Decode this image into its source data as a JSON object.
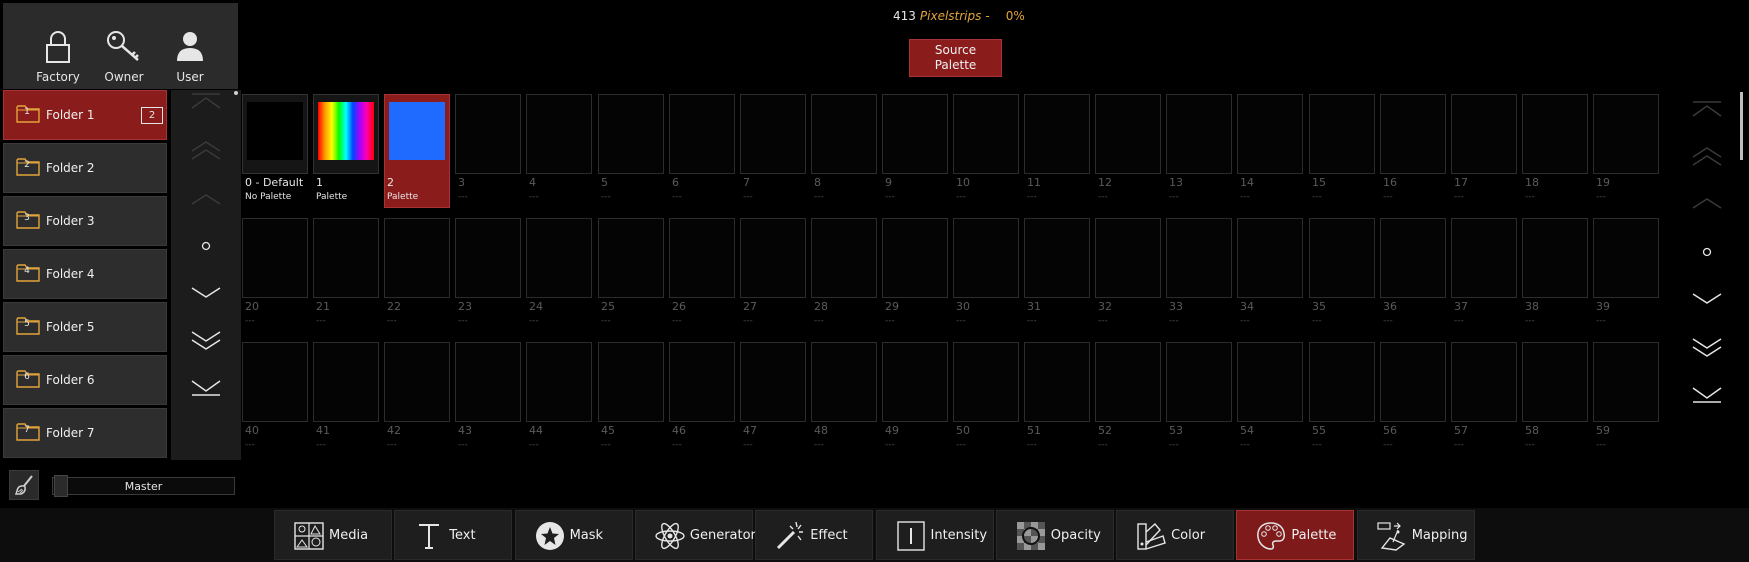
{
  "user_area": {
    "buttons": [
      {
        "label": "Factory",
        "icon": "lock-icon"
      },
      {
        "label": "Owner",
        "icon": "key-icon"
      },
      {
        "label": "User",
        "icon": "user-icon"
      }
    ]
  },
  "folders": [
    {
      "num": "1",
      "label": "Folder 1",
      "badge": "2",
      "active": true
    },
    {
      "num": "2",
      "label": "Folder 2"
    },
    {
      "num": "3",
      "label": "Folder 3"
    },
    {
      "num": "4",
      "label": "Folder 4"
    },
    {
      "num": "5",
      "label": "Folder 5"
    },
    {
      "num": "6",
      "label": "Folder 6"
    },
    {
      "num": "7",
      "label": "Folder 7"
    }
  ],
  "header": {
    "count": "413",
    "type": "Pixelstrips",
    "dash": "-",
    "percent": "0%"
  },
  "source_palette_button": {
    "line1": "Source",
    "line2": "Palette"
  },
  "grid": {
    "empty_sub": "---",
    "cells": [
      {
        "label": "0 - Default",
        "sub": "No Palette",
        "state": "used",
        "thumb": "none"
      },
      {
        "label": "1",
        "sub": "Palette",
        "state": "used",
        "thumb": "rainbow"
      },
      {
        "label": "2",
        "sub": "Palette",
        "state": "selected",
        "thumb": "blue"
      }
    ]
  },
  "master": {
    "label": "Master"
  },
  "tabs": [
    {
      "label": "Media",
      "icon": "media-icon"
    },
    {
      "label": "Text",
      "icon": "text-icon"
    },
    {
      "label": "Mask",
      "icon": "mask-icon"
    },
    {
      "label": "Generator",
      "icon": "generator-icon"
    },
    {
      "label": "Effect",
      "icon": "effect-icon"
    },
    {
      "label": "Intensity",
      "icon": "intensity-icon"
    },
    {
      "label": "Opacity",
      "icon": "opacity-icon"
    },
    {
      "label": "Color",
      "icon": "color-icon"
    },
    {
      "label": "Palette",
      "icon": "palette-icon",
      "active": true
    },
    {
      "label": "Mapping",
      "icon": "mapping-icon"
    }
  ],
  "colors": {
    "accent_red": "#8b1c1c",
    "accent_orange": "#e2a43a",
    "folder_icon": "#e2a43a",
    "palette_blue": "#1f6bff"
  }
}
